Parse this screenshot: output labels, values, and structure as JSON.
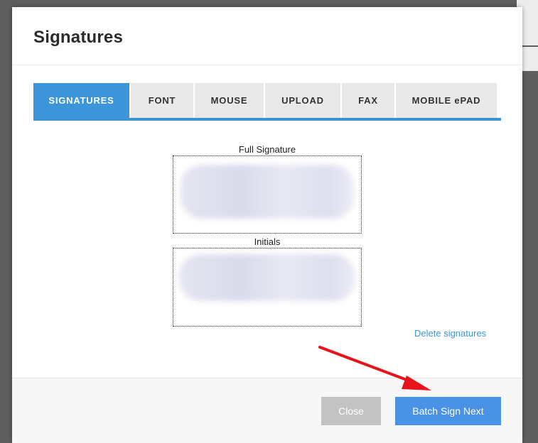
{
  "dialog": {
    "title": "Signatures"
  },
  "tabs": [
    {
      "label": "SIGNATURES",
      "active": true
    },
    {
      "label": "FONT",
      "active": false
    },
    {
      "label": "MOUSE",
      "active": false
    },
    {
      "label": "UPLOAD",
      "active": false
    },
    {
      "label": "FAX",
      "active": false
    },
    {
      "label": "MOBILE ePAD",
      "active": false
    }
  ],
  "signatures": {
    "full_caption": "Full Signature",
    "initials_caption": "Initials",
    "delete_label": "Delete signatures"
  },
  "footer": {
    "close_label": "Close",
    "batch_label": "Batch Sign Next"
  },
  "colors": {
    "accent": "#3c95d9",
    "primary_button": "#4a92e6",
    "disabled_button": "#c3c3c3",
    "annotation_arrow": "#e8141b"
  }
}
